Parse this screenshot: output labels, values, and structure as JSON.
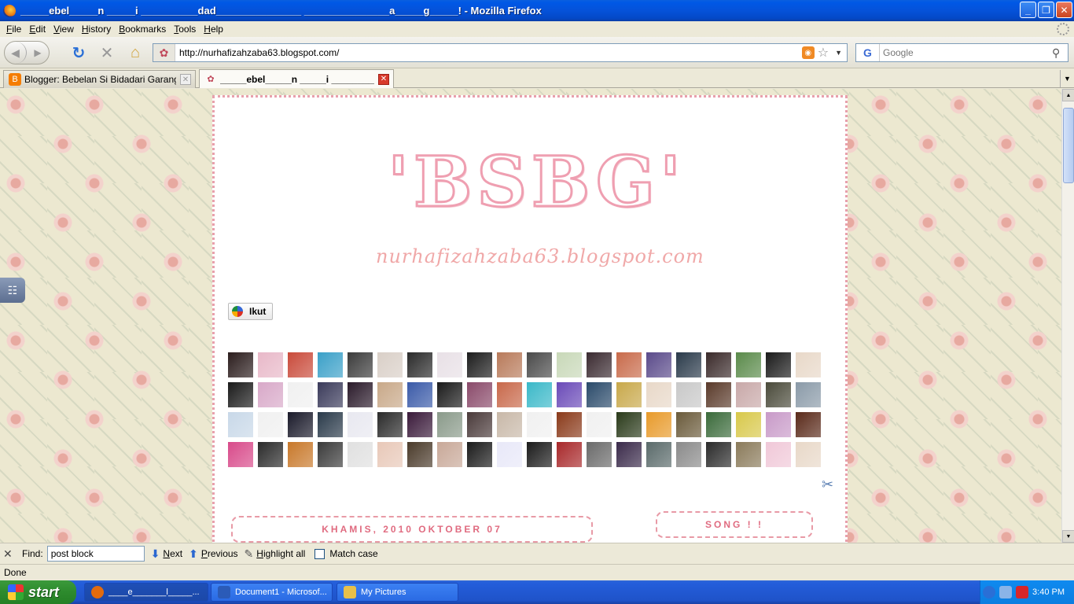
{
  "window": {
    "title": "_____ebel_____n _____i __________dad_______________ _______________a_____g_____! - Mozilla Firefox",
    "buttons": {
      "minimize": "_",
      "maximize": "❐",
      "close": "✕"
    }
  },
  "menu": [
    "File",
    "Edit",
    "View",
    "History",
    "Bookmarks",
    "Tools",
    "Help"
  ],
  "nav": {
    "url": "http://nurhafizahzaba63.blogspot.com/",
    "search_placeholder": "Google",
    "search_engine_glyph": "G"
  },
  "tabs": [
    {
      "label": "Blogger: Bebelan Si Bidadari Garang - C...",
      "active": false,
      "favicon": "blogger-icon",
      "color": "#f57d00"
    },
    {
      "label": "_____ebel_____n _____i __________d...",
      "active": true,
      "favicon": "rose-icon",
      "color": "#c0485a"
    }
  ],
  "blog": {
    "logo_title": "'BSBG'",
    "logo_subtitle": "nurhafizahzaba63.blogspot.com",
    "follow_label": "Ikut",
    "post_date": "KHAMIS, 2010 OKTOBER 07",
    "song_title": "SONG ! !",
    "accent": "#e06b80",
    "follower_colors": [
      "#2b1d1d",
      "#e8b8c8",
      "#c94a3a",
      "#3aa0c8",
      "#3b3b3b",
      "#d9cfc7",
      "#2a2a2a",
      "#e8e0e6",
      "#1c1c1c",
      "#b87a5a",
      "#4a4a4a",
      "#c8d8b8",
      "#3a2a30",
      "#c86a4a",
      "#5a4a8a",
      "#2a3a4a",
      "#3a2a2a",
      "#5a8a4a",
      "#1a1a1a",
      "#e8d8c8",
      "#1a1a1a",
      "#d8a8c8",
      "#f0f0f0",
      "#3a3a5a",
      "#2a1a2a",
      "#c8a888",
      "#3a5aa8",
      "#1a1a1a",
      "#8a4a6a",
      "#c8684a",
      "#3ab8c8",
      "#6a4ab8",
      "#2a4a6a",
      "#c8a84a",
      "#e8d8c8",
      "#c8c8c8",
      "#5a3a2a",
      "#c8a8a8",
      "#4a4a3a",
      "#8a9aa8",
      "#c8d8e8",
      "#f0f0f0",
      "#1a1a2a",
      "#2a3a4a",
      "#e8e8f0",
      "#2a2a2a",
      "#3a1a3a",
      "#8a9a8a",
      "#4a3a3a",
      "#c8b8a8",
      "#f0f0f0",
      "#8a3a1a",
      "#f0f0f0",
      "#2a3a1a",
      "#e89a2a",
      "#6a5a3a",
      "#3a6a3a",
      "#d8c84a",
      "#c89ac8",
      "#5a2a1a",
      "#d84a8a",
      "#2a2a2a",
      "#c8782a",
      "#3a3a3a",
      "#e0e0e0",
      "#e8c8b8",
      "#4a3a2a",
      "#c8a898",
      "#1a1a1a",
      "#e8e8f8",
      "#1a1a1a",
      "#a8282a",
      "#6a6a6a",
      "#3a2a4a",
      "#5a6a6a",
      "#8a8a8a",
      "#2a2a2a",
      "#8a7a5a",
      "#f0c8d8",
      "#e8d8c8"
    ]
  },
  "findbar": {
    "label": "Find:",
    "value": "post block",
    "next": "Next",
    "previous": "Previous",
    "highlight": "Highlight all",
    "match_case": "Match case"
  },
  "status": "Done",
  "taskbar": {
    "start": "start",
    "tasks": [
      {
        "label": "____e_______l_____...",
        "active": true,
        "color": "#e36b0d"
      },
      {
        "label": "Document1 - Microsof...",
        "active": false,
        "color": "#2b5bb8"
      },
      {
        "label": "My Pictures",
        "active": false,
        "color": "#e8c04a"
      }
    ],
    "clock": "3:40 PM"
  }
}
